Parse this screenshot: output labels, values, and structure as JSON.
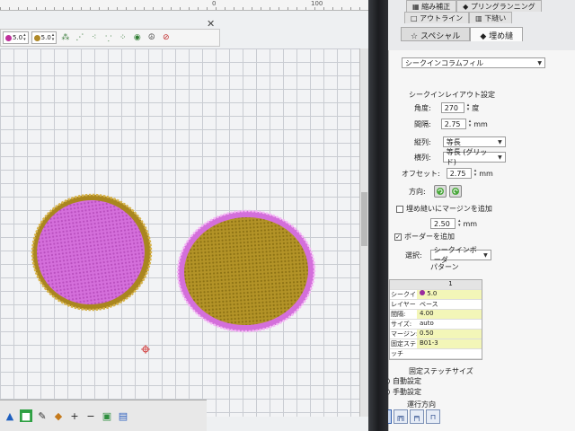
{
  "ruler": {
    "labels": [
      "0",
      "100"
    ]
  },
  "toolbar": {
    "spin1": {
      "value": "5.0",
      "color": "#c0319c"
    },
    "spin2": {
      "value": "5.0",
      "color": "#b08a2a"
    },
    "icons": [
      "stitch-icon",
      "satin-icon",
      "fill-icon",
      "run-icon",
      "pattern-icon",
      "color-icon",
      "peace-icon",
      "no-icon"
    ]
  },
  "canvas": {
    "colors": {
      "pink": "#d46fdb",
      "gold": "#b39327"
    }
  },
  "panel": {
    "tabs_row1": [
      "縮み補正",
      "プリングランニング"
    ],
    "tabs_row2": [
      "アウトライン",
      "下縫い"
    ],
    "tabs_row3": [
      "スペシャル",
      "埋め縫"
    ],
    "stitch_type": "シークインコラムフィル",
    "layout_title": "シークインレイアウト設定",
    "angle_label": "角度:",
    "angle_value": "270",
    "angle_unit": "度",
    "spacing_label": "間隔:",
    "spacing_value": "2.75",
    "spacing_unit": "mm",
    "col_label": "縦列:",
    "col_value": "等長",
    "row_label": "横列:",
    "row_value": "等長 (グリッド)",
    "offset_label": "オフセット:",
    "offset_value": "2.75",
    "offset_unit": "mm",
    "direction_label": "方向:",
    "margin_check_label": "埋め縫いにマージンを追加",
    "margin_value": "2.50",
    "margin_unit": "mm",
    "border_check_label": "ボーダーを追加",
    "select_label": "選択:",
    "select_value": "シークインボーダ",
    "select_value2": "パターン",
    "table_header_index": "1",
    "props": [
      {
        "key": "シークイン",
        "value": "5.0",
        "highlight": true
      },
      {
        "key": "レイヤー",
        "value": "ベース",
        "highlight": false
      },
      {
        "key": "間隔:",
        "value": "4.00",
        "highlight": true
      },
      {
        "key": "サイズ:",
        "value": "auto",
        "highlight": false
      },
      {
        "key": "マージン:",
        "value": "0.50",
        "highlight": true
      },
      {
        "key": "固定ステ",
        "value": "B01-3",
        "highlight": true
      },
      {
        "key": "ッチ",
        "value": "",
        "highlight": false
      }
    ],
    "fixed_size_label": "固定ステッチサイズ",
    "auto_label": "自動設定",
    "manual_label": "手動設定",
    "travel_label": "運行方向"
  }
}
